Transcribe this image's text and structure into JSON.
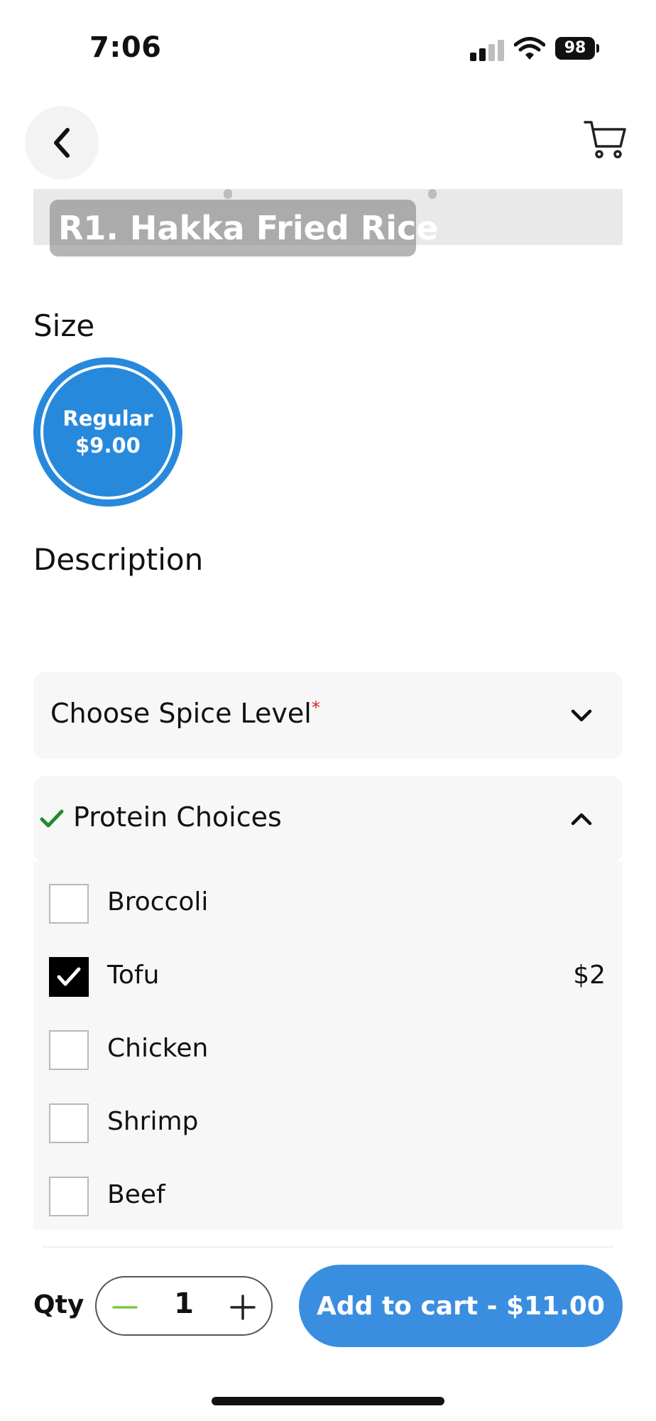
{
  "status_bar": {
    "time": "7:06",
    "battery": "98"
  },
  "nav": {
    "back_icon": "chevron-left-icon",
    "cart_icon": "cart-icon"
  },
  "item": {
    "title": "R1. Hakka Fried Rice"
  },
  "size_section": {
    "label": "Size",
    "options": [
      {
        "name": "Regular",
        "price": "$9.00",
        "selected": true
      }
    ]
  },
  "description": {
    "label": "Description"
  },
  "spice": {
    "label": "Choose Spice Level",
    "required_mark": "*",
    "expanded": false
  },
  "protein": {
    "label": "Protein Choices",
    "completed": true,
    "expanded": true,
    "options": [
      {
        "name": "Broccoli",
        "price": "",
        "checked": false
      },
      {
        "name": "Tofu",
        "price": "$2",
        "checked": true
      },
      {
        "name": "Chicken",
        "price": "",
        "checked": false
      },
      {
        "name": "Shrimp",
        "price": "",
        "checked": false
      },
      {
        "name": "Beef",
        "price": "",
        "checked": false
      }
    ]
  },
  "footer": {
    "qty_label": "Qty",
    "qty_value": "1",
    "add_button_label": "Add to cart - $11.00"
  },
  "colors": {
    "accent": "#3a8ee0",
    "size_circle": "#2789dc",
    "check_green": "#1e8c2e",
    "minus_green": "#7ac943",
    "required_red": "#e0202a"
  }
}
